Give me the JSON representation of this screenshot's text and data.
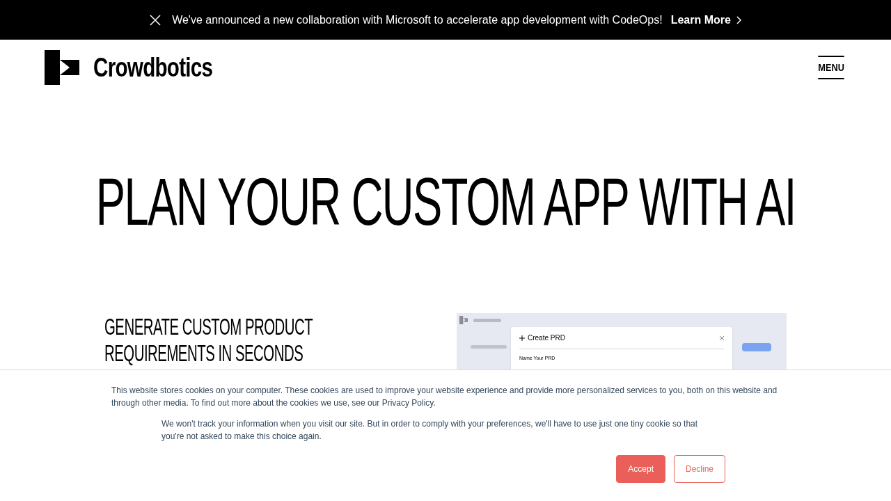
{
  "announcement": {
    "text": "We've announced a new collaboration with Microsoft to accelerate app development with CodeOps!",
    "link": "Learn More"
  },
  "header": {
    "brand": "Crowdbotics",
    "menu": "MENU"
  },
  "hero": {
    "title": "PLAN YOUR CUSTOM APP WITH AI"
  },
  "feature": {
    "title": "GENERATE CUSTOM PRODUCT REQUIREMENTS IN SECONDS",
    "screenshot": {
      "dialog_title": "Create PRD",
      "field_label": "Name Your PRD"
    }
  },
  "cookie_banner": {
    "text": "This website stores cookies on your computer. These cookies are used to improve your website experience and provide more personalized services to you, both on this website and through other media. To find out more about the cookies we use, see our Privacy Policy.",
    "note": "We won't track your information when you visit our site. But in order to comply with your preferences, we'll have to use just one tiny cookie so that you're not asked to make this choice again.",
    "buttons": [
      {
        "label": "Accept",
        "kind": "primary"
      },
      {
        "label": "Decline",
        "kind": "outline"
      }
    ]
  }
}
